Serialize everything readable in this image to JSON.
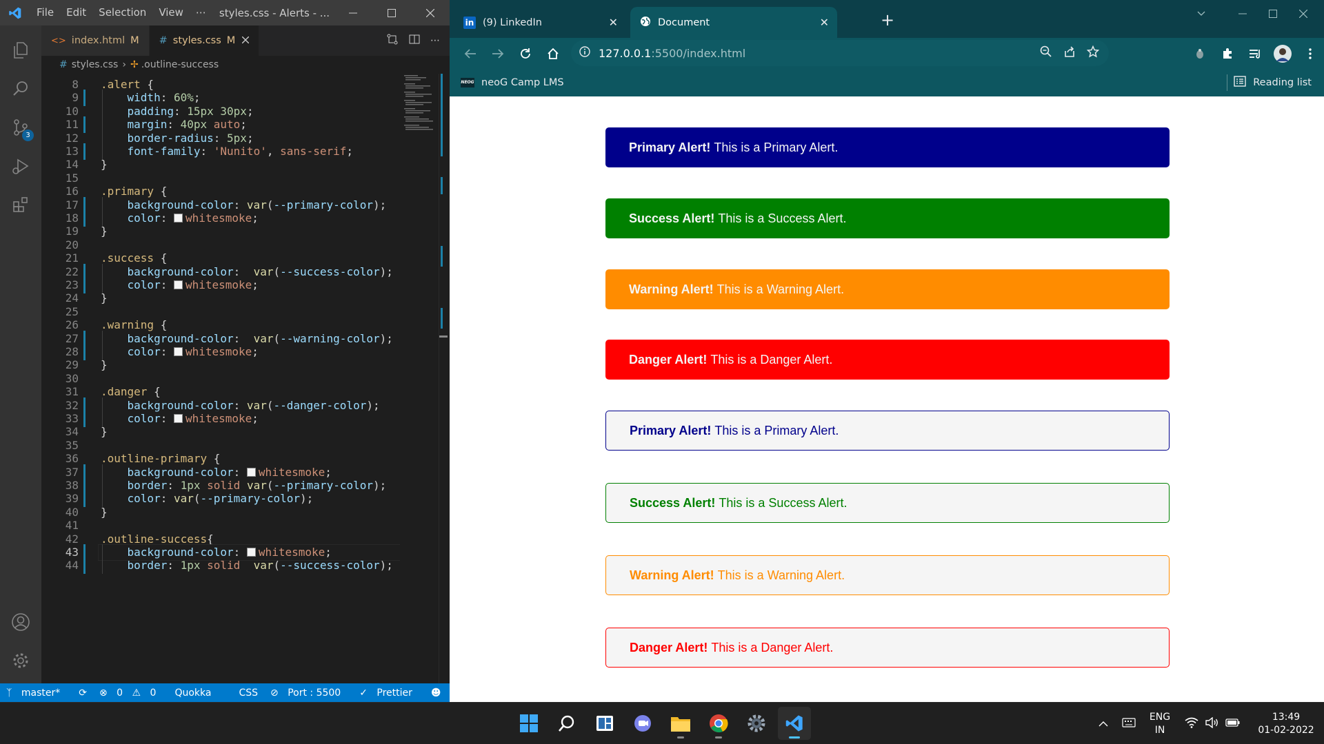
{
  "vscode": {
    "menu": [
      "File",
      "Edit",
      "Selection",
      "View",
      "⋯"
    ],
    "window_title": "styles.css - Alerts - ...",
    "scm_badge": "3",
    "tabs": [
      {
        "name": "index.html",
        "status": "M",
        "icon": "html-icon"
      },
      {
        "name": "styles.css",
        "status": "M",
        "icon": "css-icon",
        "active": true
      }
    ],
    "breadcrumb": {
      "file": "styles.css",
      "symbol": ".outline-success"
    },
    "lines": [
      {
        "n": "8",
        "t": [
          [
            ".alert",
            "sel"
          ],
          [
            " {",
            "p"
          ]
        ]
      },
      {
        "n": "9",
        "t": [
          [
            "    "
          ],
          [
            "width",
            "prop"
          ],
          [
            ": "
          ],
          [
            "60%",
            "num"
          ],
          [
            ";"
          ]
        ],
        "mod": true
      },
      {
        "n": "10",
        "t": [
          [
            "    "
          ],
          [
            "padding",
            "prop"
          ],
          [
            ": "
          ],
          [
            "15px 30px",
            "num"
          ],
          [
            ";"
          ]
        ]
      },
      {
        "n": "11",
        "t": [
          [
            "    "
          ],
          [
            "margin",
            "prop"
          ],
          [
            ": "
          ],
          [
            "40px",
            "num"
          ],
          [
            " "
          ],
          [
            "auto",
            "str"
          ],
          [
            ";"
          ]
        ],
        "mod": true
      },
      {
        "n": "12",
        "t": [
          [
            "    "
          ],
          [
            "border-radius",
            "prop"
          ],
          [
            ": "
          ],
          [
            "5px",
            "num"
          ],
          [
            ";"
          ]
        ]
      },
      {
        "n": "13",
        "t": [
          [
            "    "
          ],
          [
            "font-family",
            "prop"
          ],
          [
            ": "
          ],
          [
            "'Nunito'",
            "str"
          ],
          [
            ", "
          ],
          [
            "sans-serif",
            "str"
          ],
          [
            ";"
          ]
        ],
        "mod": true
      },
      {
        "n": "14",
        "t": [
          [
            "}"
          ]
        ]
      },
      {
        "n": "15",
        "t": []
      },
      {
        "n": "16",
        "t": [
          [
            ".primary",
            "sel"
          ],
          [
            " {"
          ]
        ]
      },
      {
        "n": "17",
        "t": [
          [
            "    "
          ],
          [
            "background-color",
            "prop"
          ],
          [
            ": "
          ],
          [
            "var",
            "fn"
          ],
          [
            "("
          ],
          [
            "--primary-color",
            "var"
          ],
          [
            ");"
          ]
        ],
        "mod": true
      },
      {
        "n": "18",
        "t": [
          [
            "    "
          ],
          [
            "color",
            "prop"
          ],
          [
            ": "
          ],
          [
            "SW"
          ],
          [
            "whitesmoke",
            "str"
          ],
          [
            ";"
          ]
        ],
        "mod": true
      },
      {
        "n": "19",
        "t": [
          [
            "}"
          ]
        ]
      },
      {
        "n": "20",
        "t": []
      },
      {
        "n": "21",
        "t": [
          [
            ".success",
            "sel"
          ],
          [
            " {"
          ]
        ]
      },
      {
        "n": "22",
        "t": [
          [
            "    "
          ],
          [
            "background-color",
            "prop"
          ],
          [
            ":  "
          ],
          [
            "var",
            "fn"
          ],
          [
            "("
          ],
          [
            "--success-color",
            "var"
          ],
          [
            ");"
          ]
        ],
        "mod": true
      },
      {
        "n": "23",
        "t": [
          [
            "    "
          ],
          [
            "color",
            "prop"
          ],
          [
            ": "
          ],
          [
            "SW"
          ],
          [
            "whitesmoke",
            "str"
          ],
          [
            ";"
          ]
        ],
        "mod": true
      },
      {
        "n": "24",
        "t": [
          [
            "}"
          ]
        ]
      },
      {
        "n": "25",
        "t": []
      },
      {
        "n": "26",
        "t": [
          [
            ".warning",
            "sel"
          ],
          [
            " {"
          ]
        ]
      },
      {
        "n": "27",
        "t": [
          [
            "    "
          ],
          [
            "background-color",
            "prop"
          ],
          [
            ":  "
          ],
          [
            "var",
            "fn"
          ],
          [
            "("
          ],
          [
            "--warning-color",
            "var"
          ],
          [
            ");"
          ]
        ],
        "mod": true
      },
      {
        "n": "28",
        "t": [
          [
            "    "
          ],
          [
            "color",
            "prop"
          ],
          [
            ": "
          ],
          [
            "SW"
          ],
          [
            "whitesmoke",
            "str"
          ],
          [
            ";"
          ]
        ],
        "mod": true
      },
      {
        "n": "29",
        "t": [
          [
            "}"
          ]
        ]
      },
      {
        "n": "30",
        "t": []
      },
      {
        "n": "31",
        "t": [
          [
            ".danger",
            "sel"
          ],
          [
            " {"
          ]
        ]
      },
      {
        "n": "32",
        "t": [
          [
            "    "
          ],
          [
            "background-color",
            "prop"
          ],
          [
            ": "
          ],
          [
            "var",
            "fn"
          ],
          [
            "("
          ],
          [
            "--danger-color",
            "var"
          ],
          [
            ");"
          ]
        ],
        "mod": true
      },
      {
        "n": "33",
        "t": [
          [
            "    "
          ],
          [
            "color",
            "prop"
          ],
          [
            ": "
          ],
          [
            "SW"
          ],
          [
            "whitesmoke",
            "str"
          ],
          [
            ";"
          ]
        ],
        "mod": true
      },
      {
        "n": "34",
        "t": [
          [
            "}"
          ]
        ]
      },
      {
        "n": "35",
        "t": []
      },
      {
        "n": "36",
        "t": [
          [
            ".outline-primary",
            "sel"
          ],
          [
            " {"
          ]
        ]
      },
      {
        "n": "37",
        "t": [
          [
            "    "
          ],
          [
            "background-color",
            "prop"
          ],
          [
            ": "
          ],
          [
            "SW"
          ],
          [
            "whitesmoke",
            "str"
          ],
          [
            ";"
          ]
        ],
        "mod": true
      },
      {
        "n": "38",
        "t": [
          [
            "    "
          ],
          [
            "border",
            "prop"
          ],
          [
            ": "
          ],
          [
            "1px",
            "num"
          ],
          [
            " "
          ],
          [
            "solid",
            "str"
          ],
          [
            " "
          ],
          [
            "var",
            "fn"
          ],
          [
            "("
          ],
          [
            "--primary-color",
            "var"
          ],
          [
            ");"
          ]
        ],
        "mod": true
      },
      {
        "n": "39",
        "t": [
          [
            "    "
          ],
          [
            "color",
            "prop"
          ],
          [
            ": "
          ],
          [
            "var",
            "fn"
          ],
          [
            "("
          ],
          [
            "--primary-color",
            "var"
          ],
          [
            ");"
          ]
        ],
        "mod": true
      },
      {
        "n": "40",
        "t": [
          [
            "}"
          ]
        ]
      },
      {
        "n": "41",
        "t": []
      },
      {
        "n": "42",
        "t": [
          [
            ".outline-success",
            "sel"
          ],
          [
            "{"
          ]
        ]
      },
      {
        "n": "43",
        "t": [
          [
            "    "
          ],
          [
            "background-color",
            "prop"
          ],
          [
            ": "
          ],
          [
            "SW"
          ],
          [
            "whitesmoke",
            "str"
          ],
          [
            ";"
          ]
        ],
        "mod": true,
        "current": true
      },
      {
        "n": "44",
        "t": [
          [
            "    "
          ],
          [
            "border",
            "prop"
          ],
          [
            ": "
          ],
          [
            "1px",
            "num"
          ],
          [
            " "
          ],
          [
            "solid",
            "str"
          ],
          [
            "  "
          ],
          [
            "var",
            "fn"
          ],
          [
            "("
          ],
          [
            "--success-color",
            "var"
          ],
          [
            ");"
          ]
        ],
        "mod": true
      }
    ],
    "status": {
      "branch": "master*",
      "errors": "0",
      "warnings": "0",
      "quokka": "Quokka",
      "language": "CSS",
      "port": "Port : 5500",
      "prettier": "Prettier"
    }
  },
  "chrome": {
    "tabs": [
      {
        "title": "(9) LinkedIn",
        "icon": "linkedin-icon"
      },
      {
        "title": "Document",
        "icon": "globe-icon",
        "active": true
      }
    ],
    "url_host": "127.0.0.1",
    "url_path": ":5500/index.html",
    "bookmark": {
      "favicon_text": "NEOG",
      "label": "neoG Camp LMS"
    },
    "reading_list": "Reading list"
  },
  "alerts": [
    {
      "strong": "Primary Alert!",
      "text": " This is a Primary Alert.",
      "style": "filled",
      "color": "#00008b"
    },
    {
      "strong": "Success Alert!",
      "text": " This is a Success Alert.",
      "style": "filled",
      "color": "#008000"
    },
    {
      "strong": "Warning Alert!",
      "text": " This is a Warning Alert.",
      "style": "filled",
      "color": "#ff8c00"
    },
    {
      "strong": "Danger Alert!",
      "text": " This is a Danger Alert.",
      "style": "filled",
      "color": "#ff0000"
    },
    {
      "strong": "Primary Alert!",
      "text": " This is a Primary Alert.",
      "style": "outline",
      "color": "#00008b"
    },
    {
      "strong": "Success Alert!",
      "text": " This is a Success Alert.",
      "style": "outline",
      "color": "#008000"
    },
    {
      "strong": "Warning Alert!",
      "text": " This is a Warning Alert.",
      "style": "outline",
      "color": "#ff8c00"
    },
    {
      "strong": "Danger Alert!",
      "text": " This is a Danger Alert.",
      "style": "outline",
      "color": "#ff0000"
    }
  ],
  "taskbar": {
    "lang_top": "ENG",
    "lang_bottom": "IN",
    "time": "13:49",
    "date": "01-02-2022"
  },
  "colors": {
    "vscode_accent": "#007acc",
    "chrome_frame": "#0d5660",
    "whitesmoke": "#f5f5f5"
  }
}
